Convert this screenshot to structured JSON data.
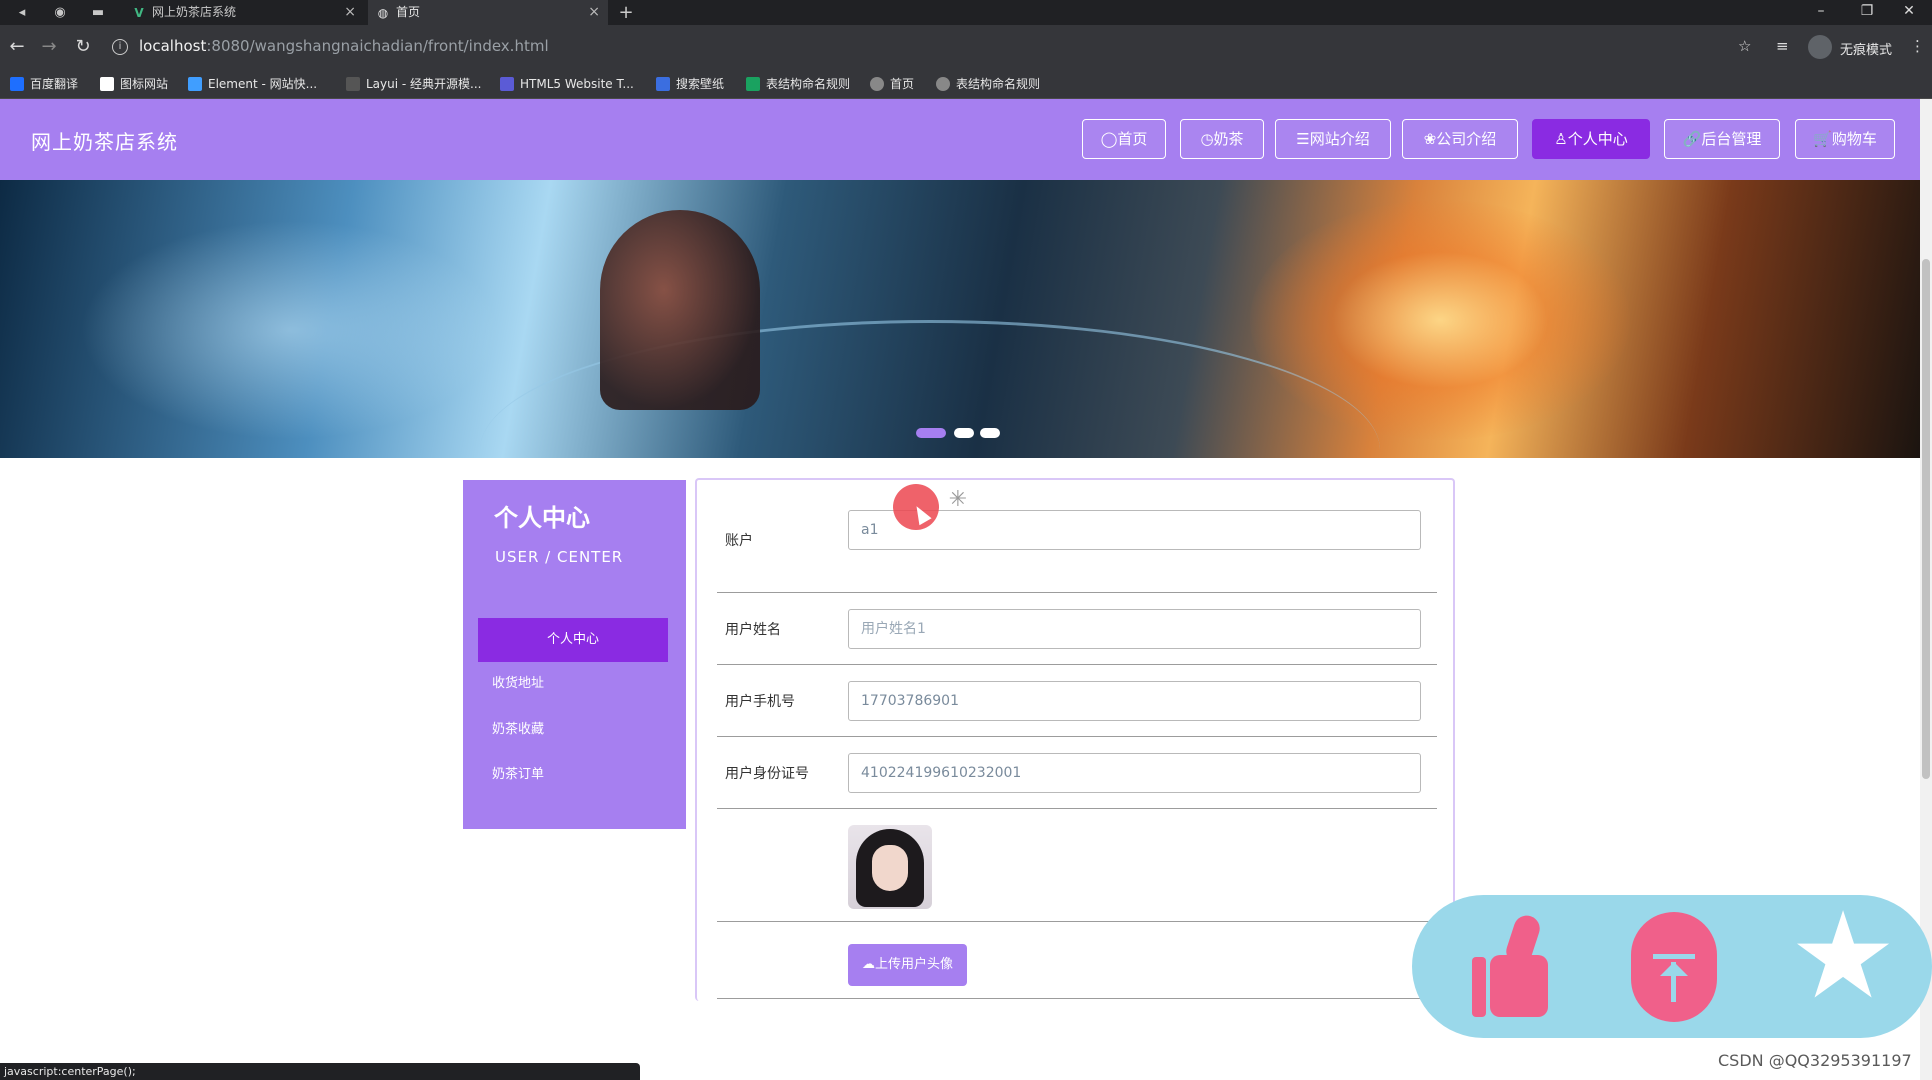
{
  "browser": {
    "tabs": [
      {
        "title": "网上奶茶店系统",
        "icon": "vue-logo-icon"
      },
      {
        "title": "首页",
        "icon": "globe-icon"
      }
    ],
    "new_tab": "+",
    "url_host": "localhost",
    "url_path": ":8080/wangshangnaichadian/front/index.html",
    "incognito_label": "无痕模式",
    "bookmarks": [
      {
        "label": "百度翻译",
        "color": "#1e6fff"
      },
      {
        "label": "图标网站",
        "color": "#ffffff"
      },
      {
        "label": "Element - 网站快...",
        "color": "#409eff"
      },
      {
        "label": "Layui - 经典开源模...",
        "color": "#cccccc"
      },
      {
        "label": "HTML5 Website T...",
        "color": "#5b5bd6"
      },
      {
        "label": "搜索壁纸",
        "color": "#3b6ee0"
      },
      {
        "label": "表结构命名规则",
        "color": "#1aa260"
      },
      {
        "label": "首页",
        "color": "#dddddd"
      },
      {
        "label": "表结构命名规则",
        "color": "#dddddd"
      }
    ],
    "status_text": "javascript:centerPage();"
  },
  "header": {
    "site_title": "网上奶茶店系统",
    "nav": [
      {
        "label": "◯首页",
        "active": false
      },
      {
        "label": "◷奶茶",
        "active": false
      },
      {
        "label": "☰网站介绍",
        "active": false
      },
      {
        "label": "❀公司介绍",
        "active": false
      },
      {
        "label": "♙个人中心",
        "active": true
      },
      {
        "label": "🔗后台管理",
        "active": false
      },
      {
        "label": "🛒购物车",
        "active": false
      }
    ],
    "accent_color": "#a67ff0",
    "active_color": "#8a2be2"
  },
  "banner": {
    "slide_count": 3,
    "active_index": 0
  },
  "sidebar": {
    "title": "个人中心",
    "subtitle": "USER / CENTER",
    "items": [
      {
        "label": "个人中心",
        "active": true
      },
      {
        "label": "收货地址",
        "active": false
      },
      {
        "label": "奶茶收藏",
        "active": false
      },
      {
        "label": "奶茶订单",
        "active": false
      }
    ]
  },
  "form": {
    "account_label": "账户",
    "account_value": "a1",
    "name_label": "用户姓名",
    "name_value": "用户姓名1",
    "phone_label": "用户手机号",
    "phone_value": "17703786901",
    "idcard_label": "用户身份证号",
    "idcard_value": "410224199610232001",
    "upload_label": "上传用户头像",
    "upload_icon": "cloud-upload-icon"
  },
  "float_widget": {
    "like_icon": "thumbs-up-icon",
    "top_icon": "back-to-top-icon",
    "star_icon": "star-icon",
    "star_glyph": "★"
  },
  "watermark": "CSDN @QQ3295391197"
}
